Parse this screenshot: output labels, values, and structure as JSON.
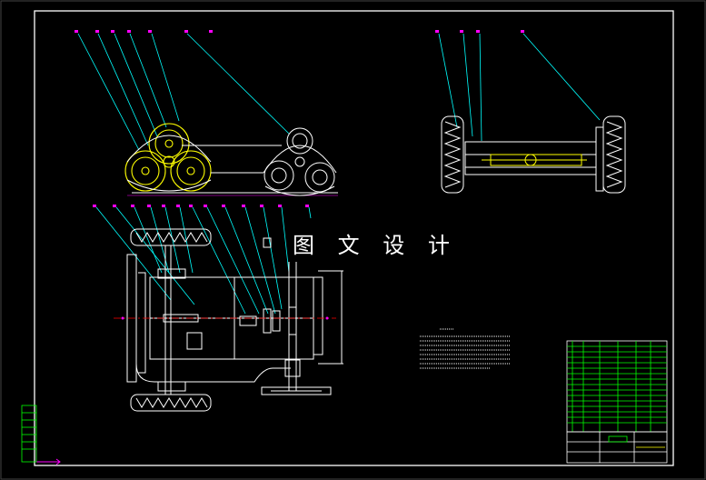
{
  "watermark": {
    "text": "图 文 设 计"
  },
  "colors": {
    "background": "#000000",
    "frame": "#ffffff",
    "leader": "#00ffff",
    "marker": "#ff00ff",
    "highlight": "#ffff00",
    "centerline": "#ff0000",
    "table": "#00ff00"
  },
  "views": [
    "top-sprocket-view",
    "side-view",
    "plan-view",
    "parts-table",
    "title-block",
    "technical-notes"
  ]
}
